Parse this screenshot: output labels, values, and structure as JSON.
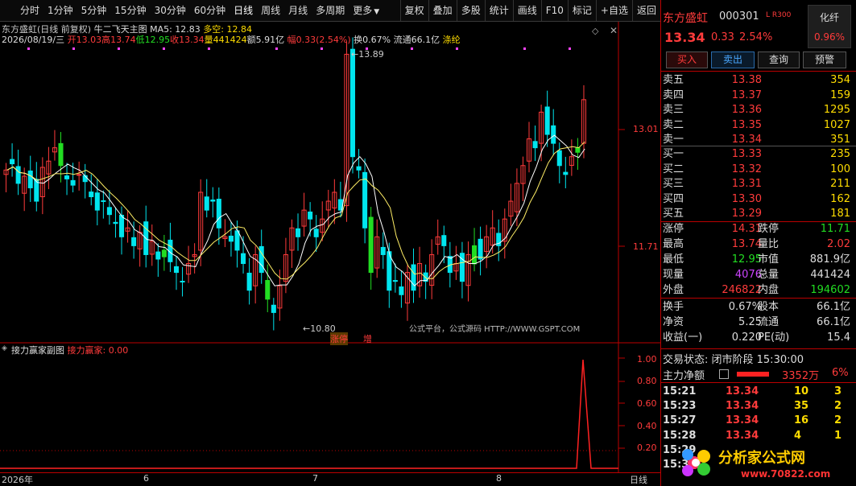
{
  "toolbar": {
    "tabs": [
      "分时",
      "1分钟",
      "5分钟",
      "15分钟",
      "30分钟",
      "60分钟",
      "日线",
      "周线",
      "月线",
      "多周期",
      "更多"
    ],
    "more_arrow": "▼",
    "right_tools": [
      "复权",
      "叠加",
      "多股",
      "统计",
      "画线",
      "F10",
      "标记",
      "+自选",
      "返回"
    ]
  },
  "chart_header": {
    "stock_title": "东方盛虹(日线 前复权)",
    "indicator": "牛二飞天主图",
    "ma5": "MA5: 12.83",
    "duokong": "多空: 12.84",
    "date": "2026/08/19/三",
    "open": "开13.03",
    "high": "高13.74",
    "low": "低12.95",
    "close": "收13.34",
    "vol": "量441424",
    "amt": "额5.91亿",
    "amp": "幅0.33(2.54%)",
    "turn": "换0.67%",
    "float": "流通66.1亿",
    "concept": "涤纶"
  },
  "price_axis": [
    "13.01",
    "11.71"
  ],
  "annotations": {
    "high_label": "13.89",
    "low_label": "10.80",
    "tag1": "涨停",
    "tag2": "增",
    "watermark": "公式平台，公式源码 HTTP://WWW.GSPT.COM"
  },
  "sub_chart": {
    "title": "接力赢家副图",
    "value_label": "接力赢家: 0.00",
    "axis": [
      "1.00",
      "0.80",
      "0.60",
      "0.40",
      "0.20"
    ]
  },
  "time_axis": [
    "2026年",
    "6",
    "7",
    "8"
  ],
  "period_label": "日线",
  "right_panel": {
    "name": "东方盛虹",
    "code": "000301",
    "flags": "L R300",
    "sector": "化纤",
    "sector_pct": "0.96%",
    "price": "13.34",
    "change": "0.33",
    "change_pct": "2.54%",
    "buttons": [
      "买入",
      "卖出",
      "查询",
      "预警"
    ],
    "asks": [
      {
        "label": "卖五",
        "price": "13.38",
        "vol": "354"
      },
      {
        "label": "卖四",
        "price": "13.37",
        "vol": "159"
      },
      {
        "label": "卖三",
        "price": "13.36",
        "vol": "1295"
      },
      {
        "label": "卖二",
        "price": "13.35",
        "vol": "1027"
      },
      {
        "label": "卖一",
        "price": "13.34",
        "vol": "351"
      }
    ],
    "bids": [
      {
        "label": "买一",
        "price": "13.33",
        "vol": "235"
      },
      {
        "label": "买二",
        "price": "13.32",
        "vol": "100"
      },
      {
        "label": "买三",
        "price": "13.31",
        "vol": "211"
      },
      {
        "label": "买四",
        "price": "13.30",
        "vol": "162"
      },
      {
        "label": "买五",
        "price": "13.29",
        "vol": "181"
      }
    ],
    "stats": [
      {
        "l": "涨停",
        "v": "14.31",
        "l2": "跌停",
        "v2": "11.71"
      },
      {
        "l": "最高",
        "v": "13.74",
        "l2": "量比",
        "v2": "2.02"
      },
      {
        "l": "最低",
        "v": "12.95",
        "l2": "市值",
        "v2": "881.9亿"
      },
      {
        "l": "现量",
        "v": "4076",
        "l2": "总量",
        "v2": "441424"
      },
      {
        "l": "外盘",
        "v": "246822",
        "l2": "内盘",
        "v2": "194602"
      }
    ],
    "stats2": [
      {
        "l": "换手",
        "v": "0.67%",
        "l2": "股本",
        "v2": "66.1亿"
      },
      {
        "l": "净资",
        "v": "5.25",
        "l2": "流通",
        "v2": "66.1亿"
      },
      {
        "l": "收益(一)",
        "v": "0.220",
        "l2": "PE(动)",
        "v2": "15.4"
      }
    ],
    "trade_state": "交易状态: 闭市阶段 15:30:00",
    "main_flow_label": "主力净额",
    "main_flow_value": "3352万",
    "main_flow_pct": "6%",
    "ticks": [
      {
        "t": "15:21",
        "p": "13.34",
        "v": "10",
        "d": "3"
      },
      {
        "t": "15:23",
        "p": "13.34",
        "v": "35",
        "d": "2"
      },
      {
        "t": "15:27",
        "p": "13.34",
        "v": "16",
        "d": "2"
      },
      {
        "t": "15:28",
        "p": "13.34",
        "v": "4",
        "d": "1"
      },
      {
        "t": "15:29",
        "p": "",
        "v": "",
        "d": ""
      },
      {
        "t": "15:30",
        "p": "",
        "v": "",
        "d": ""
      }
    ],
    "logo_text": "分析家公式网",
    "logo_url": "www.70822.com"
  },
  "colors": {
    "up": "#ff3b3b",
    "down": "#00e5ee",
    "green": "#22dd22",
    "ma": "#ffffff",
    "ma2": "#ffee66"
  }
}
